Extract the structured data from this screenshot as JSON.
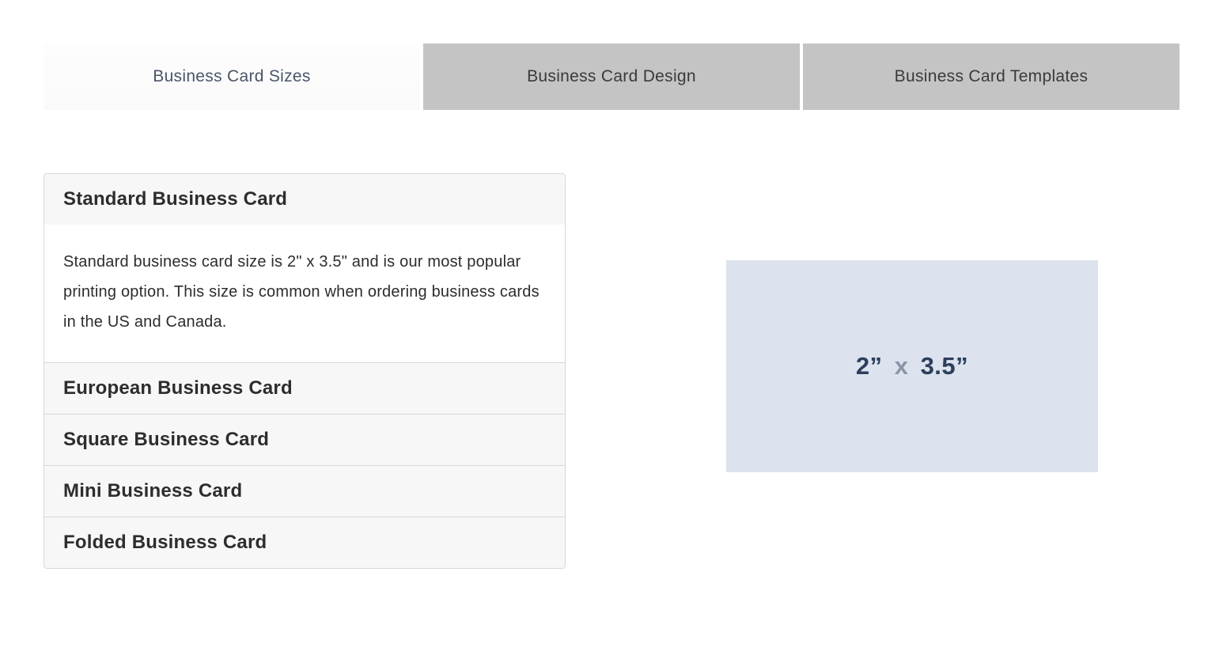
{
  "tabs": [
    {
      "label": "Business Card Sizes",
      "active": true
    },
    {
      "label": "Business Card Design",
      "active": false
    },
    {
      "label": "Business Card Templates",
      "active": false
    }
  ],
  "accordion": {
    "items": [
      {
        "title": "Standard Business Card",
        "expanded": true,
        "body": "Standard business card size is 2\" x 3.5\" and is our most popular printing option. This size is common when ordering business cards in the US and Canada."
      },
      {
        "title": "European Business Card",
        "expanded": false
      },
      {
        "title": "Square Business Card",
        "expanded": false
      },
      {
        "title": "Mini Business Card",
        "expanded": false
      },
      {
        "title": "Folded Business Card",
        "expanded": false
      }
    ]
  },
  "preview": {
    "dim1": "2”",
    "sep": "x",
    "dim2": "3.5”"
  }
}
